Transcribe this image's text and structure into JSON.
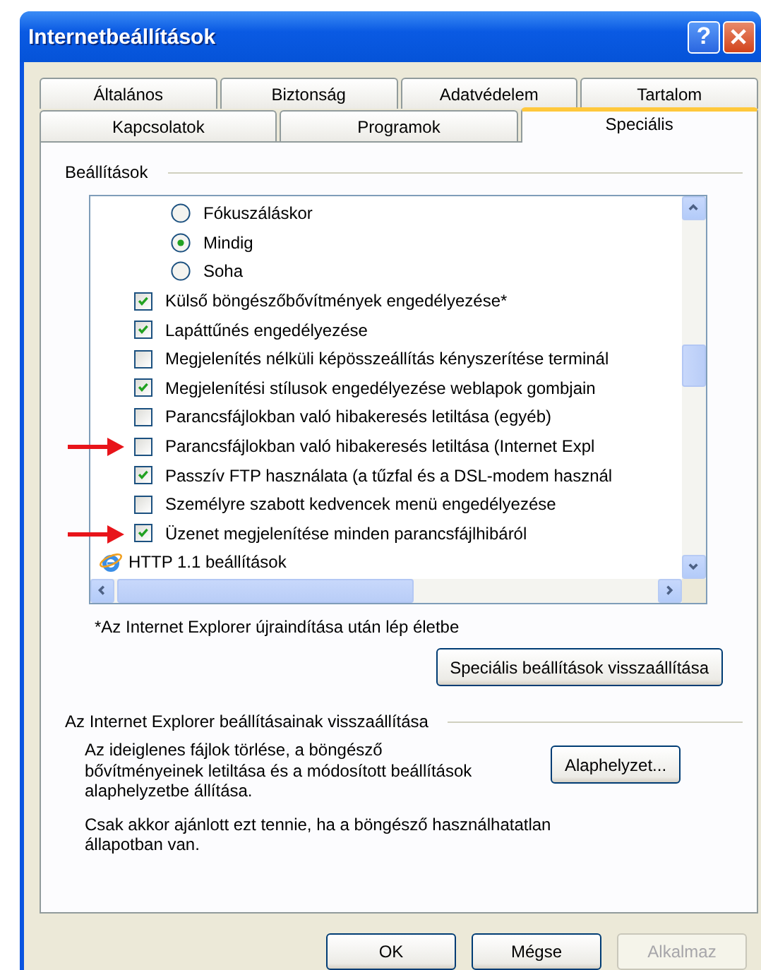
{
  "window": {
    "title": "Internetbeállítások",
    "help_button": "?"
  },
  "tab_rows": [
    {
      "tabs": [
        {
          "label": "Általános",
          "selected": false
        },
        {
          "label": "Biztonság",
          "selected": false
        },
        {
          "label": "Adatvédelem",
          "selected": false
        },
        {
          "label": "Tartalom",
          "selected": false
        }
      ]
    },
    {
      "tabs": [
        {
          "label": "Kapcsolatok",
          "selected": false
        },
        {
          "label": "Programok",
          "selected": false
        },
        {
          "label": "Speciális",
          "selected": true
        }
      ]
    }
  ],
  "settings": {
    "title": "Beállítások",
    "items": [
      {
        "kind": "radio",
        "label": "Fókuszáláskor",
        "selected": false
      },
      {
        "kind": "radio",
        "label": "Mindig",
        "selected": true
      },
      {
        "kind": "radio",
        "label": "Soha",
        "selected": false
      },
      {
        "kind": "checkbox",
        "label": "Külső böngészőbővítmények engedélyezése*",
        "checked": true,
        "marked": false
      },
      {
        "kind": "checkbox",
        "label": "Lapáttűnés engedélyezése",
        "checked": true,
        "marked": false
      },
      {
        "kind": "checkbox",
        "label": "Megjelenítés nélküli képösszeállítás kényszerítése terminál",
        "checked": false,
        "marked": false
      },
      {
        "kind": "checkbox",
        "label": "Megjelenítési stílusok engedélyezése weblapok gombjain",
        "checked": true,
        "marked": false
      },
      {
        "kind": "checkbox",
        "label": "Parancsfájlokban való hibakeresés letiltása (egyéb)",
        "checked": false,
        "marked": false
      },
      {
        "kind": "checkbox",
        "label": "Parancsfájlokban való hibakeresés letiltása (Internet Expl",
        "checked": false,
        "marked": true
      },
      {
        "kind": "checkbox",
        "label": "Passzív FTP használata (a tűzfal és a DSL-modem használ",
        "checked": true,
        "marked": false
      },
      {
        "kind": "checkbox",
        "label": "Személyre szabott kedvencek menü engedélyezése",
        "checked": false,
        "marked": false
      },
      {
        "kind": "checkbox",
        "label": "Üzenet megjelenítése minden parancsfájlhibáról",
        "checked": true,
        "marked": true
      },
      {
        "kind": "group",
        "label": "HTTP 1.1 beállítások"
      }
    ]
  },
  "restart_note": "*Az Internet Explorer újraindítása után lép életbe",
  "restore_button": "Speciális beállítások visszaállítása",
  "reset": {
    "title": "Az Internet Explorer beállításainak visszaállítása",
    "description": "Az ideiglenes fájlok törlése, a böngésző bővítményeinek letiltása és a módosított beállítások alaphelyzetbe állítása.",
    "note": "Csak akkor ajánlott ezt tennie, ha a böngésző használhatatlan állapotban van.",
    "button": "Alaphelyzet..."
  },
  "buttons": [
    {
      "label": "OK",
      "disabled": false
    },
    {
      "label": "Mégse",
      "disabled": false
    },
    {
      "label": "Alkalmaz",
      "disabled": true
    }
  ]
}
